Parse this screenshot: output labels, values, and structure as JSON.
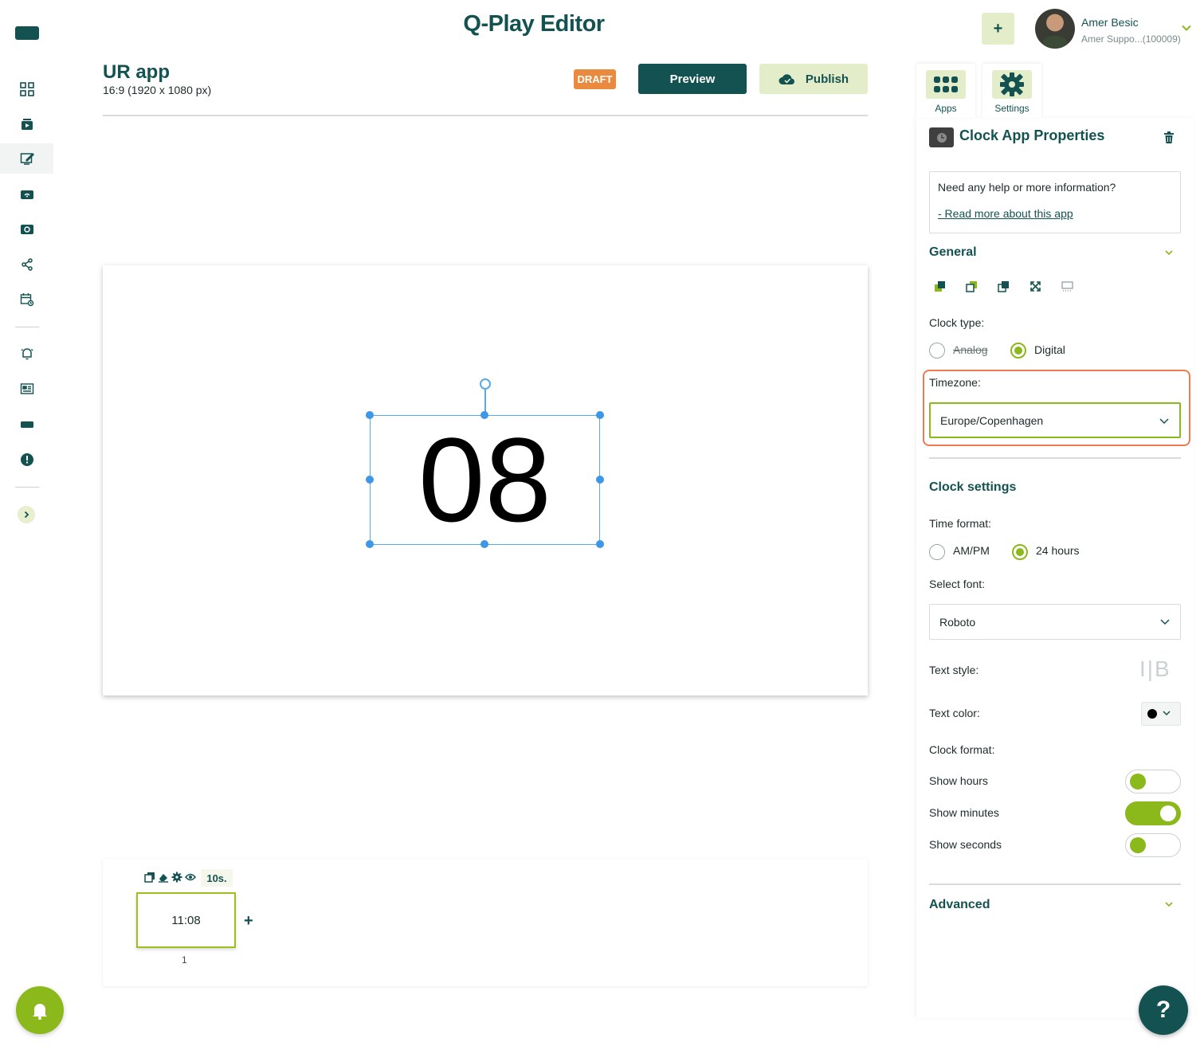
{
  "header": {
    "app_title": "Q-Play Editor",
    "add_label": "+",
    "user_name": "Amer Besic",
    "user_sub": "Amer Suppo...(100009)"
  },
  "project": {
    "title": "UR app",
    "resolution": "16:9 (1920 x 1080 px)",
    "status_badge": "DRAFT",
    "preview_label": "Preview",
    "publish_label": "Publish"
  },
  "canvas": {
    "clock_text": "08"
  },
  "timeline": {
    "duration": "10s.",
    "slide_label": "11:08",
    "slide_number": "1",
    "add_label": "+"
  },
  "panel": {
    "tabs": [
      {
        "label": "Apps"
      },
      {
        "label": "Settings"
      }
    ],
    "title": "Clock App Properties",
    "help_question": "Need any help or more information?",
    "help_link": "- Read more about this app",
    "general": {
      "title": "General",
      "clock_type_label": "Clock type:",
      "clock_type_options": [
        "Analog",
        "Digital"
      ],
      "clock_type_selected": "Digital",
      "timezone_label": "Timezone:",
      "timezone_value": "Europe/Copenhagen"
    },
    "clock_settings": {
      "title": "Clock settings",
      "time_format_label": "Time format:",
      "time_format_options": [
        "AM/PM",
        "24 hours"
      ],
      "time_format_selected": "24 hours",
      "font_label": "Select font:",
      "font_value": "Roboto",
      "text_style_label": "Text style:",
      "text_style_value": "I|B",
      "text_color_label": "Text color:",
      "text_color": "#000000",
      "clock_format_label": "Clock format:",
      "show_hours_label": "Show hours",
      "show_hours": false,
      "show_minutes_label": "Show minutes",
      "show_minutes": true,
      "show_seconds_label": "Show seconds",
      "show_seconds": false
    },
    "advanced_title": "Advanced"
  },
  "help_fab": "?",
  "colors": {
    "brand_dark": "#145252",
    "accent_green": "#8bb81a",
    "accent_light": "#e4edc9",
    "draft_orange": "#ea8a3e",
    "highlight": "#ee7a52",
    "selection_blue": "#3d97e6"
  }
}
